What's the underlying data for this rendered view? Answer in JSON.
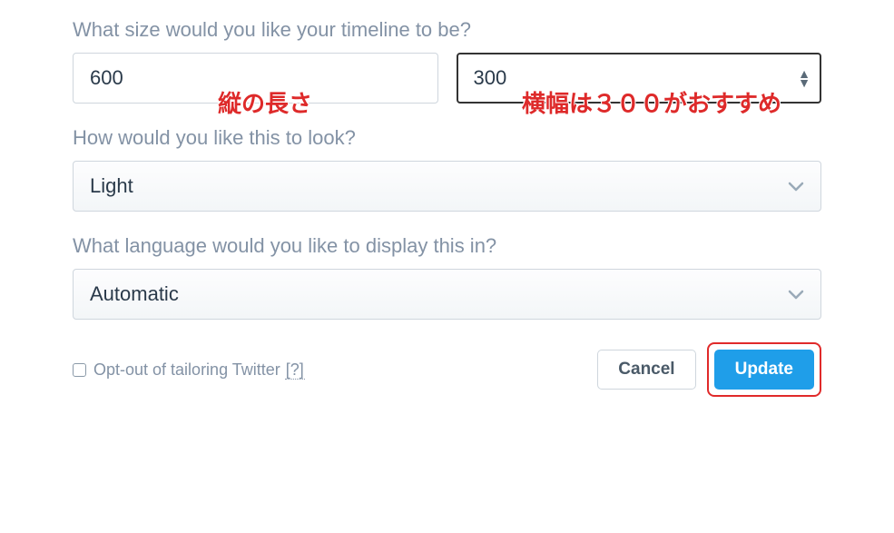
{
  "form": {
    "size_label": "What size would you like your timeline to be?",
    "height_value": "600",
    "width_value": "300",
    "look_label": "How would you like this to look?",
    "look_value": "Light",
    "language_label": "What language would you like to display this in?",
    "language_value": "Automatic",
    "optout_label": "Opt-out of tailoring Twitter ",
    "optout_help": "[?]",
    "cancel_label": "Cancel",
    "update_label": "Update"
  },
  "annotations": {
    "height_note": "縦の長さ",
    "width_note": "横幅は３００がおすすめ"
  }
}
